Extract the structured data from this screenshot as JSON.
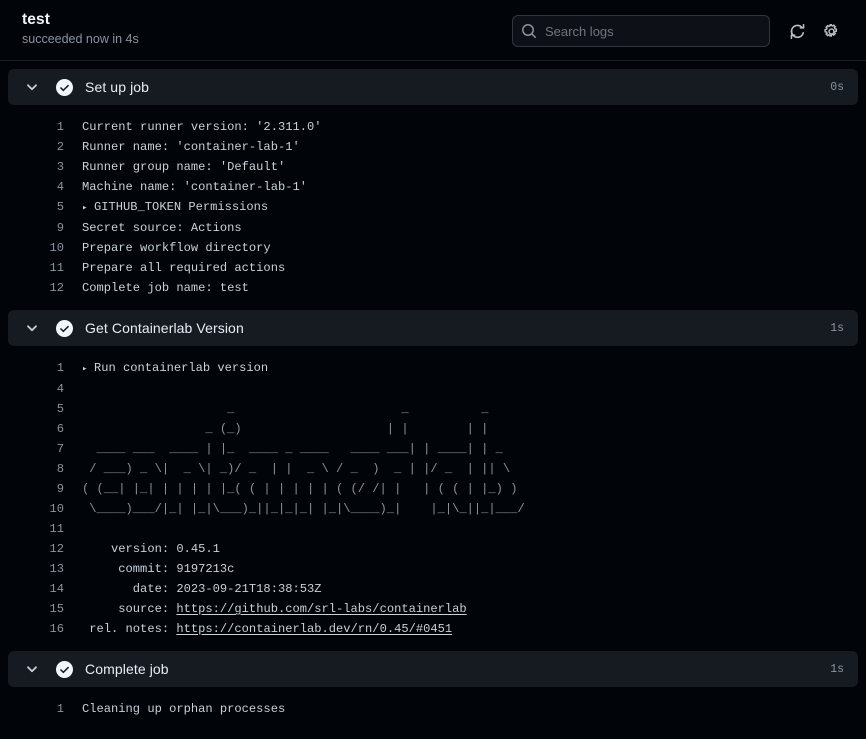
{
  "header": {
    "job_title": "test",
    "job_status": "succeeded now in 4s",
    "search": {
      "placeholder": "Search logs",
      "value": "",
      "icon": "search-icon"
    },
    "refresh_icon": "refresh-icon",
    "settings_icon": "gear-icon"
  },
  "steps": [
    {
      "name": "Set up job",
      "status_icon": "check-circle-icon",
      "chevron_icon": "chevron-down-icon",
      "duration": "0s",
      "lines": [
        {
          "n": "1",
          "text": "Current runner version: '2.311.0'",
          "expandable": false
        },
        {
          "n": "2",
          "text": "Runner name: 'container-lab-1'",
          "expandable": false
        },
        {
          "n": "3",
          "text": "Runner group name: 'Default'",
          "expandable": false
        },
        {
          "n": "4",
          "text": "Machine name: 'container-lab-1'",
          "expandable": false
        },
        {
          "n": "5",
          "text": "GITHUB_TOKEN Permissions",
          "expandable": true
        },
        {
          "n": "9",
          "text": "Secret source: Actions",
          "expandable": false
        },
        {
          "n": "10",
          "text": "Prepare workflow directory",
          "expandable": false
        },
        {
          "n": "11",
          "text": "Prepare all required actions",
          "expandable": false
        },
        {
          "n": "12",
          "text": "Complete job name: test",
          "expandable": false
        }
      ]
    },
    {
      "name": "Get Containerlab Version",
      "status_icon": "check-circle-icon",
      "chevron_icon": "chevron-down-icon",
      "duration": "1s",
      "lines": [
        {
          "n": "1",
          "text": "Run containerlab version",
          "expandable": true
        },
        {
          "n": "4",
          "text": "",
          "expandable": false
        },
        {
          "n": "5",
          "text": "                    _                       _          _",
          "art": true
        },
        {
          "n": "6",
          "text": "                 _ (_)                    | |        | |",
          "art": true
        },
        {
          "n": "7",
          "text": "  ____ ___  ____ | |_  ____ _ ____   ____ ___| | ____| | _",
          "art": true
        },
        {
          "n": "8",
          "text": " / ___) _ \\|  _ \\| _)/ _  | |  _ \\ / _  )  _ | |/ _  | || \\",
          "art": true
        },
        {
          "n": "9",
          "text": "( (__| |_| | | | | |_( ( | | | | | ( (/ /| |   | ( ( | |_) )",
          "art": true
        },
        {
          "n": "10",
          "text": " \\____)___/|_| |_|\\___)_||_|_|_| |_|\\____)_|    |_|\\_||_|___/",
          "art": true
        },
        {
          "n": "11",
          "text": "",
          "expandable": false
        },
        {
          "n": "12",
          "text": "    version: 0.45.1",
          "expandable": false
        },
        {
          "n": "13",
          "text": "     commit: 9197213c",
          "expandable": false
        },
        {
          "n": "14",
          "text": "       date: 2023-09-21T18:38:53Z",
          "expandable": false
        },
        {
          "n": "15",
          "text": "     source: ",
          "expandable": false,
          "link": "https://github.com/srl-labs/containerlab"
        },
        {
          "n": "16",
          "text": " rel. notes: ",
          "expandable": false,
          "link": "https://containerlab.dev/rn/0.45/#0451"
        }
      ]
    },
    {
      "name": "Complete job",
      "status_icon": "check-circle-icon",
      "chevron_icon": "chevron-down-icon",
      "duration": "1s",
      "lines": [
        {
          "n": "1",
          "text": "Cleaning up orphan processes",
          "expandable": false
        }
      ]
    }
  ],
  "colors": {
    "page_bg": "#010409",
    "step_header_bg": "#161b22",
    "text": "#c9d1d9",
    "muted": "#8b949e",
    "title": "#f0f6fc",
    "border": "#30363d"
  }
}
